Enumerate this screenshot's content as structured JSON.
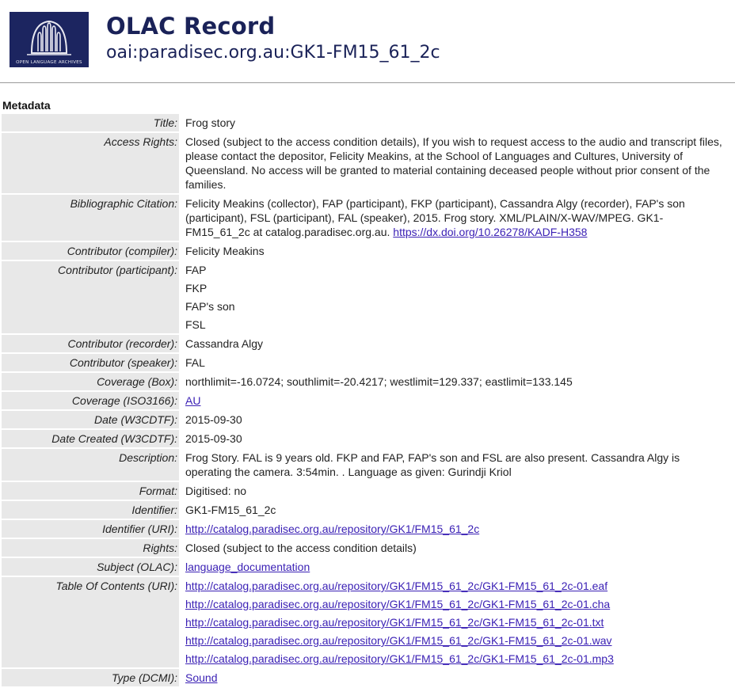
{
  "header": {
    "title": "OLAC Record",
    "identifier": "oai:paradisec.org.au:GK1-FM15_61_2c",
    "logo_text": "OPEN LANGUAGE ARCHIVES"
  },
  "section_label": "Metadata",
  "rows": [
    {
      "label": "Title:",
      "values": [
        "Frog story"
      ]
    },
    {
      "label": "Access Rights:",
      "values": [
        "Closed (subject to the access condition details), If you wish to request access to the audio and transcript files, please contact the depositor, Felicity Meakins, at the School of Languages and Cultures, University of Queensland. No access will be granted to material containing deceased people without prior consent of the families."
      ]
    },
    {
      "label": "Bibliographic Citation:",
      "values": [
        "Felicity Meakins (collector), FAP (participant), FKP (participant), Cassandra Algy (recorder), FAP's son (participant), FSL (participant), FAL (speaker), 2015. Frog story. XML/PLAIN/X-WAV/MPEG. GK1-FM15_61_2c at catalog.paradisec.org.au. "
      ],
      "link": "https://dx.doi.org/10.26278/KADF-H358"
    },
    {
      "label": "Contributor (compiler):",
      "values": [
        "Felicity Meakins"
      ]
    },
    {
      "label": "Contributor (participant):",
      "values": [
        "FAP",
        "FKP",
        "FAP's son",
        "FSL"
      ]
    },
    {
      "label": "Contributor (recorder):",
      "values": [
        "Cassandra Algy"
      ]
    },
    {
      "label": "Contributor (speaker):",
      "values": [
        "FAL"
      ]
    },
    {
      "label": "Coverage (Box):",
      "values": [
        "northlimit=-16.0724; southlimit=-20.4217; westlimit=129.337; eastlimit=133.145"
      ]
    },
    {
      "label": "Coverage (ISO3166):",
      "links": [
        "AU"
      ]
    },
    {
      "label": "Date (W3CDTF):",
      "values": [
        "2015-09-30"
      ]
    },
    {
      "label": "Date Created (W3CDTF):",
      "values": [
        "2015-09-30"
      ]
    },
    {
      "label": "Description:",
      "values": [
        "Frog Story. FAL is 9 years old. FKP and FAP, FAP's son and FSL are also present. Cassandra Algy is operating the camera. 3:54min. . Language as given: Gurindji Kriol"
      ]
    },
    {
      "label": "Format:",
      "values": [
        "Digitised: no"
      ]
    },
    {
      "label": "Identifier:",
      "values": [
        "GK1-FM15_61_2c"
      ]
    },
    {
      "label": "Identifier (URI):",
      "links": [
        "http://catalog.paradisec.org.au/repository/GK1/FM15_61_2c"
      ]
    },
    {
      "label": "Rights:",
      "values": [
        "Closed (subject to the access condition details)"
      ]
    },
    {
      "label": "Subject (OLAC):",
      "links": [
        "language_documentation"
      ]
    },
    {
      "label": "Table Of Contents (URI):",
      "links": [
        "http://catalog.paradisec.org.au/repository/GK1/FM15_61_2c/GK1-FM15_61_2c-01.eaf",
        "http://catalog.paradisec.org.au/repository/GK1/FM15_61_2c/GK1-FM15_61_2c-01.cha",
        "http://catalog.paradisec.org.au/repository/GK1/FM15_61_2c/GK1-FM15_61_2c-01.txt",
        "http://catalog.paradisec.org.au/repository/GK1/FM15_61_2c/GK1-FM15_61_2c-01.wav",
        "http://catalog.paradisec.org.au/repository/GK1/FM15_61_2c/GK1-FM15_61_2c-01.mp3"
      ]
    },
    {
      "label": "Type (DCMI):",
      "links": [
        "Sound"
      ]
    }
  ],
  "colors": {
    "link": "#3b21b5",
    "header_text": "#1a2258",
    "label_bg": "#e8e8e8"
  }
}
